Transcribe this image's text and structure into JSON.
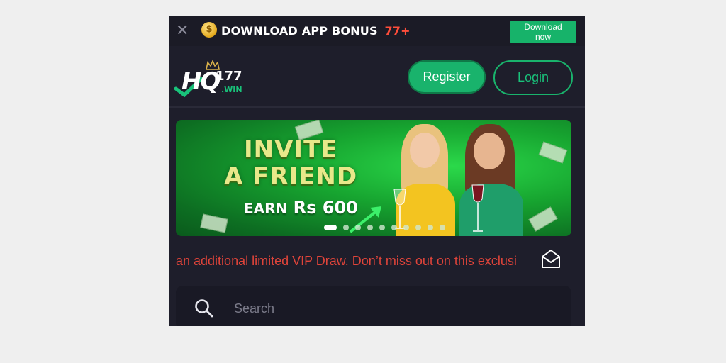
{
  "topbar": {
    "coin_symbol": "$",
    "download_app_text": "DOWNLOAD APP",
    "bonus_text": "BONUS",
    "bonus_value": "77+",
    "download_button": "Download now",
    "close_icon": "close-icon"
  },
  "header": {
    "logo": {
      "hq": "HQ",
      "number": "177",
      "domain": ".WIN"
    },
    "register_label": "Register",
    "login_label": "Login"
  },
  "banner": {
    "line1": "INVITE",
    "line2": "A FRIEND",
    "earn_label": "EARN",
    "earn_currency": "Rs",
    "earn_amount": "600",
    "slide_count": 10,
    "active_slide": 1
  },
  "marquee": {
    "text": "an additional limited VIP Draw. Don’t miss out on this exclusi"
  },
  "search": {
    "placeholder": "Search"
  },
  "colors": {
    "accent": "#19b36c",
    "marquee": "#e0443a",
    "bonus": "#ff4d3a",
    "background": "#1e1e2b"
  }
}
